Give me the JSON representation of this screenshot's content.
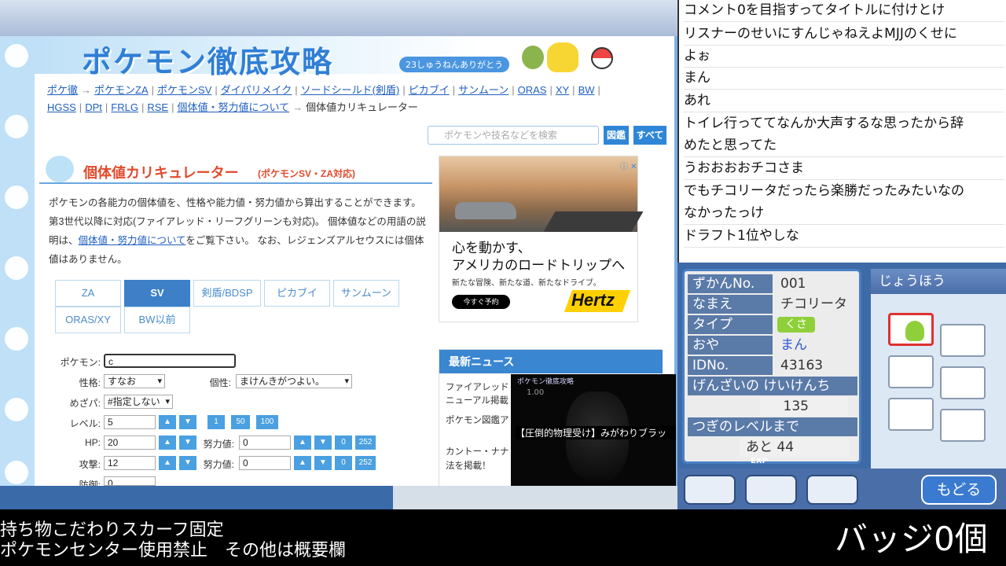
{
  "site": {
    "banner_title": "ポケモン徹底攻略",
    "banner_sub": "23しゅうねんありがとう",
    "breadcrumb_line1": [
      "ポケ徹",
      "ポケモンZA",
      "ポケモンSV",
      "ダイパリメイク",
      "ソードシールド(剣盾)",
      "ピカブイ",
      "サンムーン",
      "ORAS",
      "XY",
      "BW"
    ],
    "breadcrumb_line2": [
      "HGSS",
      "DPt",
      "FRLG",
      "RSE",
      "個体値・努力値について"
    ],
    "breadcrumb_current": "個体値カリキュレーター",
    "search_placeholder": "ポケモンや技名などを検索",
    "search_btn_zukan": "図鑑",
    "search_btn_all": "すべて"
  },
  "calc": {
    "title": "個体値カリキュレーター",
    "title_sub": "(ポケモンSV・ZA対応)",
    "desc1": "ポケモンの各能力の個体値を、性格や能力値・努力値から算出することができます。第3世代以降に対応(ファイアレッド・リーフグリーンも対応)。 個体値などの用語の説明は、",
    "desc_link": "個体値・努力値について",
    "desc2": "をご覧下さい。 なお、レジェンズアルセウスには個体値はありません。",
    "tabs": [
      "ZA",
      "SV",
      "剣盾/BDSP",
      "ピカブイ",
      "サンムーン",
      "ORAS/XY",
      "BW以前"
    ],
    "labels": {
      "pokemon": "ポケモン:",
      "nature": "性格:",
      "individuality": "個性:",
      "hidden_power": "めざパ:",
      "level": "レベル:",
      "hp": "HP:",
      "attack": "攻撃:",
      "defense": "防御:",
      "ev": "努力値:"
    },
    "values": {
      "pokemon": "c",
      "nature": "すなお",
      "individuality": "まけんきがつよい。",
      "hidden_power": "#指定しない",
      "level": "5",
      "hp": "20",
      "attack": "12",
      "hp_ev": "0",
      "attack_ev": "0",
      "defense": "0",
      "defense_ev": "0"
    },
    "level_buttons": [
      "▲",
      "▼",
      "1",
      "50",
      "100"
    ],
    "stat_buttons": [
      "▲",
      "▼",
      "0",
      "252"
    ]
  },
  "ad": {
    "headline1": "心を動かす、",
    "headline2": "アメリカのロードトリップへ",
    "sub": "新たな冒険、新たな道、新たなドライブ。",
    "button": "今すぐ予約",
    "brand": "Hertz",
    "info": "ⓘ ✕"
  },
  "news": {
    "title": "最新ニュース",
    "items": [
      "ファイアレッド",
      "ニューアル掲載",
      "ポケモン図鑑ア",
      "カントー・ナナ",
      "法を掲載！"
    ]
  },
  "video": {
    "logo": "ポケモン徹底攻略",
    "num": "1.00",
    "caption": "【圧倒的物理受け】みがわりブラッ"
  },
  "chat": {
    "lines": [
      "コメント0を目指すってタイトルに付けとけ",
      "リスナーのせいにすんじゃねえよMJJのくせに",
      "よぉ",
      "まん",
      "あれ",
      "トイレ行っててなんか大声するな思ったから辞",
      "めたと思ってた",
      "うおおおおチコさま",
      "でもチコリータだったら楽勝だったみたいなの",
      "なかったっけ",
      "ドラフト1位やしな"
    ]
  },
  "game": {
    "labels": [
      "ずかんNo.",
      "なまえ",
      "タイプ",
      "おや",
      "IDNo."
    ],
    "dex_no": "001",
    "name": "チコリータ",
    "type": "くさ",
    "owner": "まん",
    "id_no": "43163",
    "exp_label": "げんざいの けいけんち",
    "exp_value": "135",
    "next_label": "つぎのレベルまで",
    "next_value": "あと 44",
    "exp_tag": "EXP",
    "info_head": "じょうほう",
    "back_button": "もどる"
  },
  "overlay": {
    "rule1": "持ち物こだわりスカーフ固定",
    "rule2": "ポケモンセンター使用禁止　その他は概要欄",
    "badges": "バッジ0個"
  },
  "colors": {
    "accent": "#2f86d6",
    "title_red": "#e24a2c",
    "grass": "#8fd03a"
  }
}
